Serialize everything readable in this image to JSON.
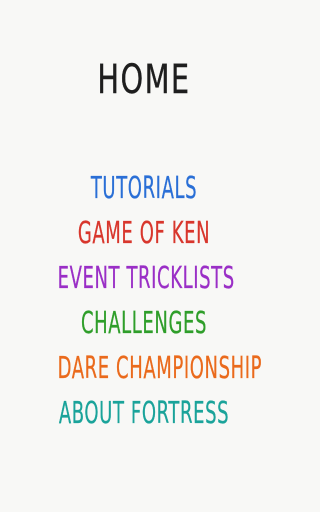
{
  "header": {
    "title": "HOME"
  },
  "menu": {
    "items": [
      {
        "label": "TUTORIALS",
        "color": "#2a6fd6"
      },
      {
        "label": "GAME OF KEN",
        "color": "#d8362c"
      },
      {
        "label": "EVENT TRICKLISTS",
        "color": "#9a2fc6"
      },
      {
        "label": "CHALLENGES",
        "color": "#2f9e2a"
      },
      {
        "label": "DARE CHAMPIONSHIP",
        "color": "#ea6a1c"
      },
      {
        "label": "ABOUT FORTRESS",
        "color": "#1aa39a"
      }
    ]
  }
}
